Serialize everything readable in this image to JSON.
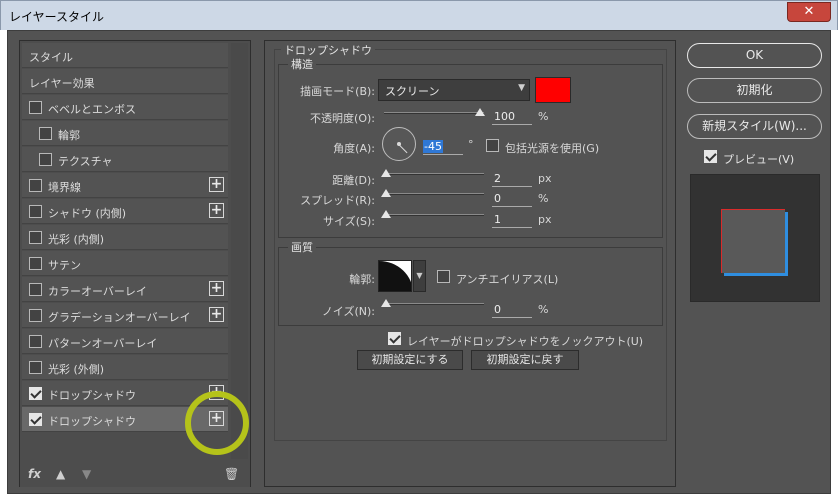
{
  "window": {
    "title": "レイヤースタイル",
    "close_glyph": "✕"
  },
  "sidebar": {
    "items": [
      {
        "label": "スタイル"
      },
      {
        "label": "レイヤー効果"
      },
      {
        "label": "ベベルとエンボス",
        "checked": false
      },
      {
        "label": "輪郭",
        "checked": false
      },
      {
        "label": "テクスチャ",
        "checked": false
      },
      {
        "label": "境界線",
        "checked": false,
        "plus": "+"
      },
      {
        "label": "シャドウ (内側)",
        "checked": false,
        "plus": "+"
      },
      {
        "label": "光彩 (内側)",
        "checked": false
      },
      {
        "label": "サテン",
        "checked": false
      },
      {
        "label": "カラーオーバーレイ",
        "checked": false,
        "plus": "+"
      },
      {
        "label": "グラデーションオーバーレイ",
        "checked": false,
        "plus": "+"
      },
      {
        "label": "パターンオーバーレイ",
        "checked": false
      },
      {
        "label": "光彩 (外側)",
        "checked": false
      },
      {
        "label": "ドロップシャドウ",
        "checked": true,
        "plus": "+"
      },
      {
        "label": "ドロップシャドウ",
        "checked": true,
        "plus": "+",
        "selected": true
      }
    ],
    "bottom": {
      "fx": "fx",
      "up": "▲",
      "down": "▼",
      "trash": "🗑"
    }
  },
  "main": {
    "section_title": "ドロップシャドウ",
    "structure": {
      "title": "構造",
      "blend_mode_label": "描画モード(B):",
      "blend_mode_value": "スクリーン",
      "shadow_color": "#ff0000",
      "opacity_label": "不透明度(O):",
      "opacity_value": "100",
      "opacity_unit": "%",
      "angle_label": "角度(A):",
      "angle_value": "-45",
      "angle_unit": "°",
      "global_light_label": "包括光源を使用(G)",
      "global_light_checked": false,
      "distance_label": "距離(D):",
      "distance_value": "2",
      "distance_unit": "px",
      "spread_label": "スプレッド(R):",
      "spread_value": "0",
      "spread_unit": "%",
      "size_label": "サイズ(S):",
      "size_value": "1",
      "size_unit": "px"
    },
    "quality": {
      "title": "画質",
      "contour_label": "輪郭:",
      "antialias_label": "アンチエイリアス(L)",
      "antialias_checked": false,
      "noise_label": "ノイズ(N):",
      "noise_value": "0",
      "noise_unit": "%"
    },
    "knockout_label": "レイヤーがドロップシャドウをノックアウト(U)",
    "knockout_checked": true,
    "make_default_button": "初期設定にする",
    "reset_default_button": "初期設定に戻す"
  },
  "right": {
    "ok_button": "OK",
    "reset_button": "初期化",
    "new_style_button": "新規スタイル(W)...",
    "preview_label": "プレビュー(V)",
    "preview_checked": true
  }
}
